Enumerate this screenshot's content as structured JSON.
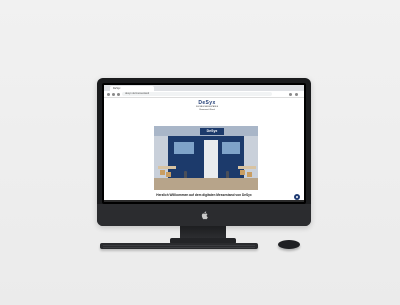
{
  "browser": {
    "tab_title": "DeSyx",
    "url": "desyx.de/messestand"
  },
  "page": {
    "logo_word": "DeSyx",
    "logo_tagline": "DIGITALE MESSESTÄNDE",
    "logo_subline": "Showroom & Stand",
    "booth_sign": "DeSyx",
    "welcome_text": "Herzlich Willkommen auf dem digitalen Messestand von DeSyx"
  },
  "colors": {
    "brand": "#1f3b73",
    "background": "#efefef"
  },
  "icons": {
    "chat": "chat-icon",
    "apple": "apple-logo-icon"
  }
}
